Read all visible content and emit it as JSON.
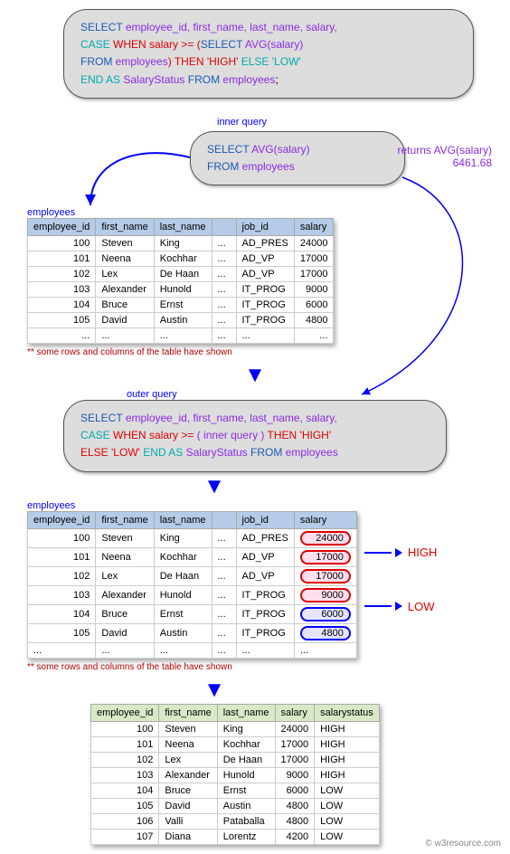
{
  "labels": {
    "inner_query": "inner query",
    "outer_query": "outer query",
    "employees": "employees",
    "returns_avg": "returns AVG(salary)",
    "avg_value": "6461.68",
    "footnote": "** some rows and columns of the table have shown",
    "high": "HIGH",
    "low": "LOW",
    "watermark": "© w3resource.com"
  },
  "sql_main": {
    "l1": {
      "select": "SELECT",
      "cols": "  employee_id,  first_name, last_name, salary,"
    },
    "l2": {
      "case": "CASE",
      "when": "WHEN salary >= ",
      "open": " (",
      "select": "SELECT",
      "avg": " AVG(salary)"
    },
    "l3": {
      "from": "FROM",
      "tbl": " employees",
      "close": ")",
      "then": " THEN 'HIGH' ",
      "else": " ELSE 'LOW'"
    },
    "l4": {
      "end": "END AS",
      "alias": " SalaryStatus",
      "from": " FROM",
      "tbl": " employees",
      ";": ";"
    }
  },
  "sql_inner": {
    "l1": {
      "select": "SELECT",
      "avg": " AVG(salary)"
    },
    "l2": {
      "from": "FROM",
      "tbl": " employees"
    }
  },
  "sql_outer": {
    "l1": {
      "select": "SELECT",
      "cols": "  employee_id,  first_name, last_name, salary,"
    },
    "l2": {
      "case": "CASE",
      "when": " WHEN salary >= ",
      "inner": "( inner query )",
      "then": "  THEN 'HIGH'"
    },
    "l3": {
      "else": "ELSE 'LOW'",
      "end": "  END AS",
      "alias": " SalaryStatus",
      "from": " FROM",
      "tbl": " employees"
    }
  },
  "tbl1": {
    "headers": [
      "employee_id",
      "first_name",
      "last_name",
      "",
      "job_id",
      "salary"
    ],
    "rows": [
      [
        "100",
        "Steven",
        "King",
        "...",
        "AD_PRES",
        "24000"
      ],
      [
        "101",
        "Neena",
        "Kochhar",
        "...",
        "AD_VP",
        "17000"
      ],
      [
        "102",
        "Lex",
        "De Haan",
        "...",
        "AD_VP",
        "17000"
      ],
      [
        "103",
        "Alexander",
        "Hunold",
        "...",
        "IT_PROG",
        "9000"
      ],
      [
        "104",
        "Bruce",
        "Ernst",
        "...",
        "IT_PROG",
        "6000"
      ],
      [
        "105",
        "David",
        "Austin",
        "...",
        "IT_PROG",
        "4800"
      ],
      [
        "...",
        "...",
        "...",
        "...",
        "...",
        "..."
      ]
    ]
  },
  "tbl3": {
    "headers": [
      "employee_id",
      "first_name",
      "last_name",
      "salary",
      "salarystatus"
    ],
    "rows": [
      [
        "100",
        "Steven",
        "King",
        "24000",
        "HIGH"
      ],
      [
        "101",
        "Neena",
        "Kochhar",
        "17000",
        "HIGH"
      ],
      [
        "102",
        "Lex",
        "De Haan",
        "17000",
        "HIGH"
      ],
      [
        "103",
        "Alexander",
        "Hunold",
        "9000",
        "HIGH"
      ],
      [
        "104",
        "Bruce",
        "Ernst",
        "6000",
        "LOW"
      ],
      [
        "105",
        "David",
        "Austin",
        "4800",
        "LOW"
      ],
      [
        "106",
        "Valli",
        "Pataballa",
        "4800",
        "LOW"
      ],
      [
        "107",
        "Diana",
        "Lorentz",
        "4200",
        "LOW"
      ]
    ]
  }
}
